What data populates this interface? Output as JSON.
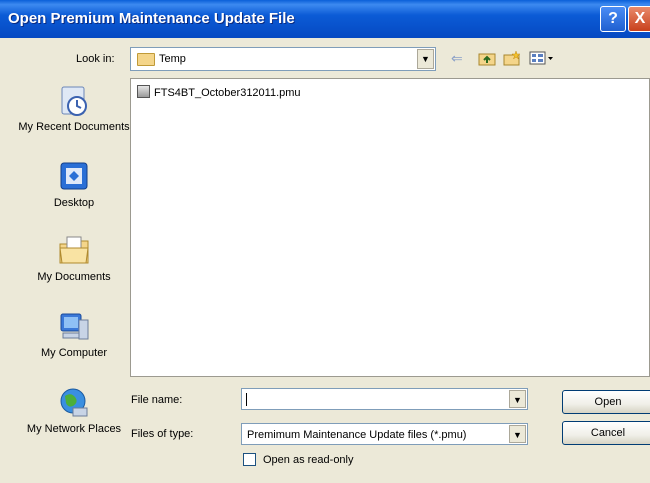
{
  "window": {
    "title": "Open Premium Maintenance Update File",
    "help_label": "?",
    "close_label": "X"
  },
  "look_in": {
    "label": "Look in:",
    "value": "Temp"
  },
  "toolbar": {
    "icons": [
      "back-arrow-icon",
      "up-folder-icon",
      "new-folder-icon",
      "views-menu-icon"
    ]
  },
  "places": [
    {
      "label": "My Recent Documents",
      "icon": "recent-documents-icon"
    },
    {
      "label": "Desktop",
      "icon": "desktop-icon"
    },
    {
      "label": "My Documents",
      "icon": "my-documents-icon"
    },
    {
      "label": "My Computer",
      "icon": "my-computer-icon"
    },
    {
      "label": "My Network Places",
      "icon": "network-places-icon"
    }
  ],
  "files": [
    {
      "name": "FTS4BT_October312011.pmu"
    }
  ],
  "file_name": {
    "label": "File name:",
    "value": ""
  },
  "files_of_type": {
    "label": "Files of type:",
    "value": "Premimum Maintenance Update files (*.pmu)"
  },
  "buttons": {
    "open": "Open",
    "cancel": "Cancel"
  },
  "read_only": {
    "label": "Open as read-only",
    "checked": false
  }
}
